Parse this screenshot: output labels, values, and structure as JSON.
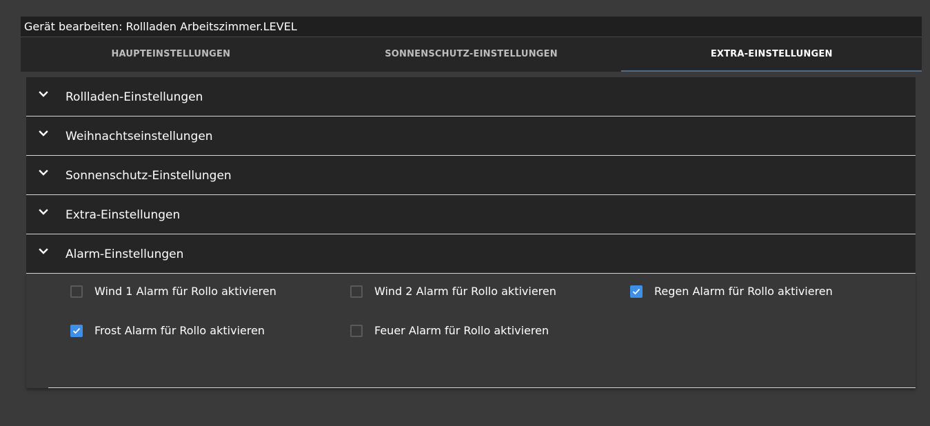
{
  "dialog": {
    "title": "Gerät bearbeiten: Rollladen Arbeitszimmer.LEVEL",
    "tabs": [
      {
        "label": "HAUPTEINSTELLUNGEN",
        "active": false
      },
      {
        "label": "SONNENSCHUTZ-EINSTELLUNGEN",
        "active": false
      },
      {
        "label": "EXTRA-EINSTELLUNGEN",
        "active": true
      }
    ]
  },
  "sections": [
    {
      "label": "Rollladen-Einstellungen",
      "icon": "chevron-down-icon"
    },
    {
      "label": "Weihnachtseinstellungen",
      "icon": "chevron-down-icon"
    },
    {
      "label": "Sonnenschutz-Einstellungen",
      "icon": "chevron-down-icon"
    },
    {
      "label": "Extra-Einstellungen",
      "icon": "chevron-down-icon"
    },
    {
      "label": "Alarm-Einstellungen",
      "icon": "chevron-down-icon",
      "expanded": true
    }
  ],
  "alarm": {
    "checkboxes": [
      {
        "label": "Wind 1 Alarm für Rollo aktivieren",
        "checked": false
      },
      {
        "label": "Wind 2 Alarm für Rollo aktivieren",
        "checked": false
      },
      {
        "label": "Regen Alarm für Rollo aktivieren",
        "checked": true
      },
      {
        "label": "Frost Alarm für Rollo aktivieren",
        "checked": true
      },
      {
        "label": "Feuer Alarm für Rollo aktivieren",
        "checked": false
      }
    ]
  },
  "colors": {
    "background": "#3a3a3a",
    "accent_checkbox": "#3d8fe8",
    "active_tab_indicator": "#4d6f8c",
    "section_header": "#252525"
  }
}
